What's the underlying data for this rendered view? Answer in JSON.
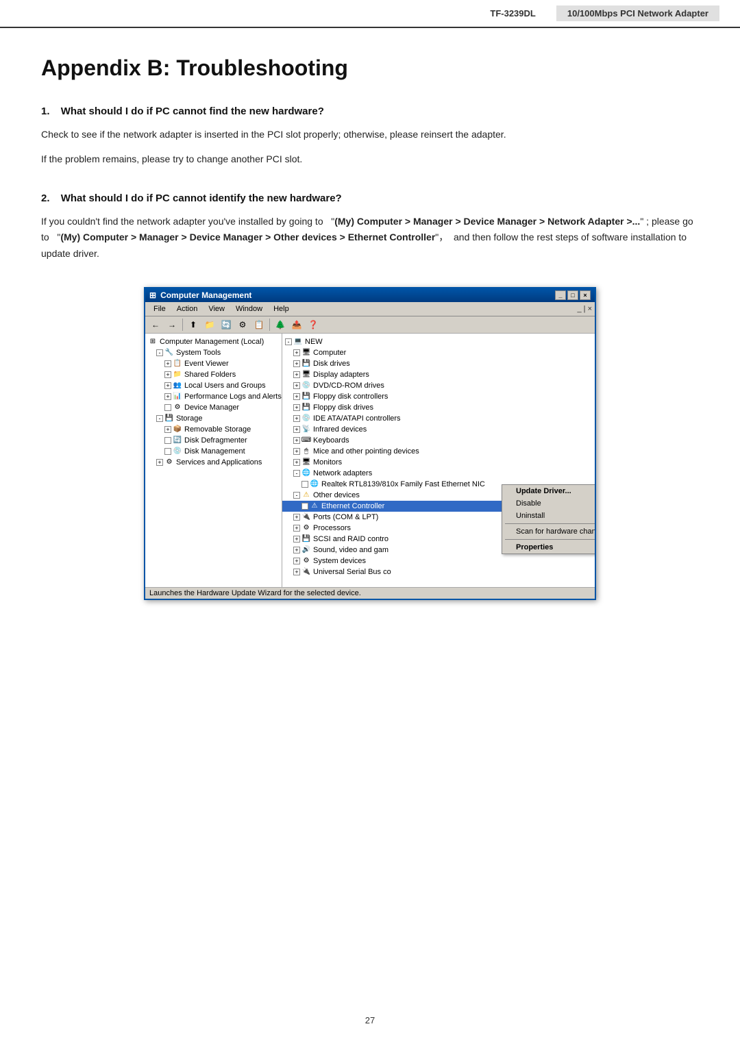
{
  "header": {
    "model": "TF-3239DL",
    "product": "10/100Mbps PCI Network Adapter"
  },
  "page": {
    "title": "Appendix B: Troubleshooting",
    "number": "27"
  },
  "sections": [
    {
      "id": "section1",
      "number": "1.",
      "heading": "What should I do if PC cannot find the new hardware?",
      "paragraphs": [
        "Check to see if the network adapter is inserted in the PCI slot properly; otherwise, please reinsert the adapter.",
        "If the problem remains, please try to change another PCI slot."
      ]
    },
    {
      "id": "section2",
      "number": "2.",
      "heading": "What should I do if PC cannot identify the new hardware?",
      "paragraph_parts": [
        {
          "text": "If you couldn't find the network adapter you've installed by going to  \"",
          "bold": false
        },
        {
          "text": "(My) Computer > Manager > Device Manager > Network Adapter >...",
          "bold": true
        },
        {
          "text": "\" ; please go to  \"",
          "bold": false
        },
        {
          "text": "(My) Computer > Manager > Device Manager > Other devices > Ethernet Controller",
          "bold": true
        },
        {
          "text": "\"，  and then follow the rest steps of software installation to update driver.",
          "bold": false
        }
      ]
    }
  ],
  "window": {
    "title": "Computer Management",
    "title_icon": "⊞",
    "buttons": {
      "minimize": "_",
      "maximize": "□",
      "close": "×"
    },
    "menu_items": [
      "File",
      "Action",
      "View",
      "Window",
      "Help"
    ],
    "menu_right": "_ | ×",
    "left_panel": {
      "items": [
        {
          "indent": 1,
          "expand": null,
          "icon": "⊞",
          "label": "Computer Management (Local)",
          "depth": 0
        },
        {
          "indent": 2,
          "expand": "-",
          "icon": "🔧",
          "label": "System Tools",
          "depth": 1
        },
        {
          "indent": 3,
          "expand": "+",
          "icon": "📋",
          "label": "Event Viewer",
          "depth": 2
        },
        {
          "indent": 3,
          "expand": "+",
          "icon": "📁",
          "label": "Shared Folders",
          "depth": 2
        },
        {
          "indent": 3,
          "expand": "+",
          "icon": "👥",
          "label": "Local Users and Groups",
          "depth": 2
        },
        {
          "indent": 3,
          "expand": "+",
          "icon": "📊",
          "label": "Performance Logs and Alerts",
          "depth": 2
        },
        {
          "indent": 3,
          "expand": null,
          "icon": "⚙",
          "label": "Device Manager",
          "depth": 2
        },
        {
          "indent": 2,
          "expand": "-",
          "icon": "💾",
          "label": "Storage",
          "depth": 1
        },
        {
          "indent": 3,
          "expand": "+",
          "icon": "📦",
          "label": "Removable Storage",
          "depth": 2
        },
        {
          "indent": 3,
          "expand": null,
          "icon": "🔄",
          "label": "Disk Defragmenter",
          "depth": 2
        },
        {
          "indent": 3,
          "expand": null,
          "icon": "💿",
          "label": "Disk Management",
          "depth": 2
        },
        {
          "indent": 2,
          "expand": "+",
          "icon": "⚙",
          "label": "Services and Applications",
          "depth": 1
        }
      ]
    },
    "right_panel": {
      "items": [
        {
          "indent": 1,
          "expand": "-",
          "icon": "💻",
          "label": "NEW",
          "depth": 0
        },
        {
          "indent": 2,
          "expand": "+",
          "icon": "🖥",
          "label": "Computer",
          "depth": 1
        },
        {
          "indent": 2,
          "expand": "+",
          "icon": "💾",
          "label": "Disk drives",
          "depth": 1
        },
        {
          "indent": 2,
          "expand": "+",
          "icon": "🖥",
          "label": "Display adapters",
          "depth": 1
        },
        {
          "indent": 2,
          "expand": "+",
          "icon": "💿",
          "label": "DVD/CD-ROM drives",
          "depth": 1
        },
        {
          "indent": 2,
          "expand": "+",
          "icon": "💾",
          "label": "Floppy disk controllers",
          "depth": 1
        },
        {
          "indent": 2,
          "expand": "+",
          "icon": "💾",
          "label": "Floppy disk drives",
          "depth": 1
        },
        {
          "indent": 2,
          "expand": "+",
          "icon": "💿",
          "label": "IDE ATA/ATAPI controllers",
          "depth": 1
        },
        {
          "indent": 2,
          "expand": "+",
          "icon": "📡",
          "label": "Infrared devices",
          "depth": 1
        },
        {
          "indent": 2,
          "expand": "+",
          "icon": "⌨",
          "label": "Keyboards",
          "depth": 1
        },
        {
          "indent": 2,
          "expand": "+",
          "icon": "🖱",
          "label": "Mice and other pointing devices",
          "depth": 1
        },
        {
          "indent": 2,
          "expand": "+",
          "icon": "🖥",
          "label": "Monitors",
          "depth": 1
        },
        {
          "indent": 2,
          "expand": "-",
          "icon": "🌐",
          "label": "Network adapters",
          "depth": 1
        },
        {
          "indent": 3,
          "expand": null,
          "icon": "🌐",
          "label": "Realtek RTL8139/810x Family Fast Ethernet NIC",
          "depth": 2
        },
        {
          "indent": 2,
          "expand": "-",
          "icon": "⚠",
          "label": "Other devices",
          "depth": 1
        },
        {
          "indent": 3,
          "expand": null,
          "icon": "⚠",
          "label": "Ethernet Controller",
          "depth": 2,
          "selected": true
        },
        {
          "indent": 2,
          "expand": "+",
          "icon": "🔌",
          "label": "Ports (COM & LPT)",
          "depth": 1
        },
        {
          "indent": 2,
          "expand": "+",
          "icon": "⚙",
          "label": "Processors",
          "depth": 1
        },
        {
          "indent": 2,
          "expand": "+",
          "icon": "💾",
          "label": "SCSI and RAID contro",
          "depth": 1
        },
        {
          "indent": 2,
          "expand": "+",
          "icon": "🔊",
          "label": "Sound, video and gam",
          "depth": 1
        },
        {
          "indent": 2,
          "expand": "+",
          "icon": "⚙",
          "label": "System devices",
          "depth": 1
        },
        {
          "indent": 2,
          "expand": "+",
          "icon": "🔌",
          "label": "Universal Serial Bus co",
          "depth": 1
        }
      ]
    },
    "context_menu": {
      "items": [
        {
          "label": "Update Driver...",
          "highlighted": true
        },
        {
          "label": "Disable"
        },
        {
          "label": "Uninstall"
        },
        {
          "separator": true
        },
        {
          "label": "Scan for hardware changes"
        },
        {
          "separator": true
        },
        {
          "label": "Properties",
          "bold": true
        }
      ]
    },
    "status_bar": "Launches the Hardware Update Wizard for the selected device."
  }
}
